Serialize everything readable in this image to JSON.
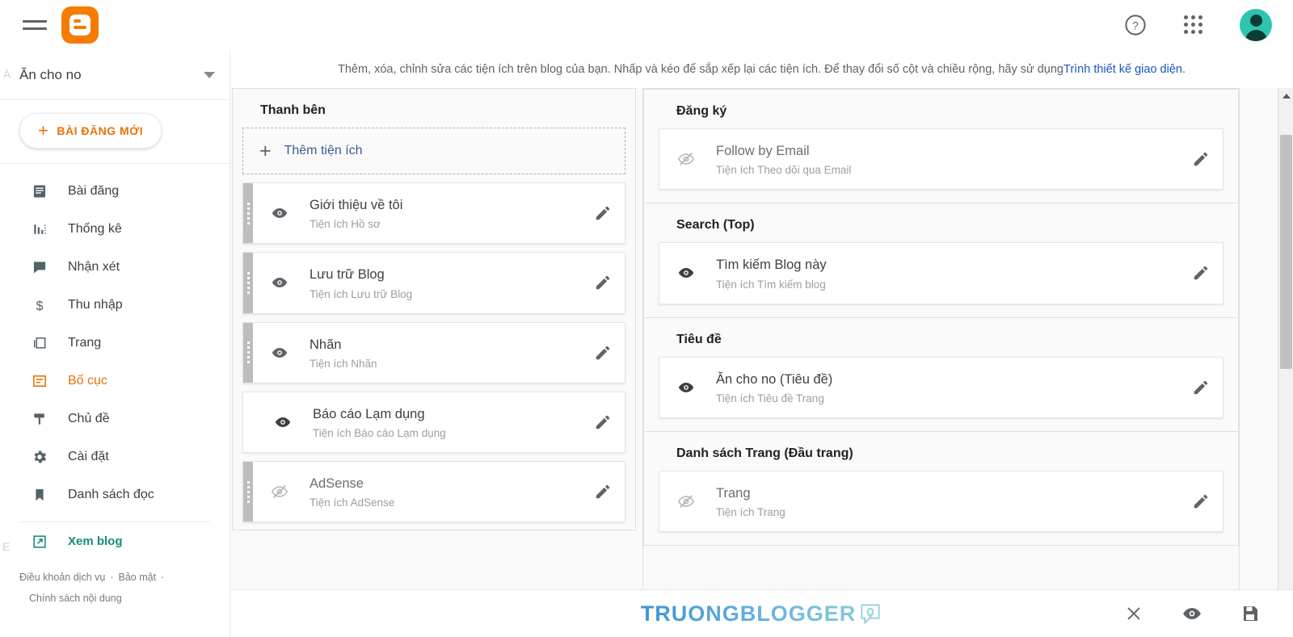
{
  "topbar": {
    "menu_icon": "hamburger-menu-icon",
    "logo_icon": "blogger-logo-icon",
    "help_icon": "help-circle-icon",
    "apps_icon": "google-apps-grid-icon",
    "avatar_icon": "user-avatar-icon",
    "avatar_color": "#2ec4b0"
  },
  "leftnav": {
    "blog_name": "Ăn cho no",
    "dropdown_icon": "chevron-down-icon",
    "new_post_label": "BÀI ĐĂNG MỚI",
    "new_post_plus": "+",
    "items": [
      {
        "label": "Bài đăng",
        "icon": "posts-icon",
        "active": false
      },
      {
        "label": "Thống kê",
        "icon": "stats-icon",
        "active": false
      },
      {
        "label": "Nhận xét",
        "icon": "comments-icon",
        "active": false
      },
      {
        "label": "Thu nhập",
        "icon": "earnings-icon",
        "active": false
      },
      {
        "label": "Trang",
        "icon": "pages-icon",
        "active": false
      },
      {
        "label": "Bố cục",
        "icon": "layout-icon",
        "active": true
      },
      {
        "label": "Chủ đề",
        "icon": "theme-icon",
        "active": false
      },
      {
        "label": "Cài đặt",
        "icon": "settings-gear-icon",
        "active": false
      },
      {
        "label": "Danh sách đọc",
        "icon": "reading-list-bookmark-icon",
        "active": false
      }
    ],
    "view_blog": {
      "label": "Xem blog",
      "icon": "external-link-icon"
    },
    "legal": {
      "terms": "Điều khoản dịch vụ",
      "privacy": "Bảo mật",
      "content_policy": "Chính sách nội dung",
      "separator": "·"
    },
    "active_color": "#e8710a"
  },
  "hint": {
    "text": "Thêm, xóa, chỉnh sửa các tiện ích trên blog của bạn. Nhấp và kéo để sắp xếp lại các tiện ích. Để thay đổi số cột và chiều rộng, hãy sử dụng ",
    "link": "Trình thiết kế giao diện",
    "period": ".",
    "link_color": "#1a56c4"
  },
  "left_column": {
    "title": "Thanh bên",
    "add_widget": {
      "label": "Thêm tiện ích",
      "plus": "+"
    },
    "widgets": [
      {
        "name": "Giới thiệu về tôi",
        "sub": "Tiện ích Hồ sơ",
        "visible": true,
        "handle": true,
        "eye_icon": "eye-visible-icon",
        "edit_icon": "pencil-edit-icon"
      },
      {
        "name": "Lưu trữ Blog",
        "sub": "Tiện ích Lưu trữ Blog",
        "visible": true,
        "handle": true,
        "eye_icon": "eye-visible-icon",
        "edit_icon": "pencil-edit-icon"
      },
      {
        "name": "Nhãn",
        "sub": "Tiện ích Nhãn",
        "visible": true,
        "handle": true,
        "eye_icon": "eye-visible-icon",
        "edit_icon": "pencil-edit-icon"
      },
      {
        "name": "Báo cáo Lạm dụng",
        "sub": "Tiện ích Báo cáo Lạm dụng",
        "visible": true,
        "handle": false,
        "eye_icon": "eye-visible-icon",
        "edit_icon": "pencil-edit-icon"
      },
      {
        "name": "AdSense",
        "sub": "Tiện ích AdSense",
        "visible": false,
        "handle": true,
        "eye_icon": "eye-hidden-icon",
        "edit_icon": "pencil-edit-icon"
      }
    ]
  },
  "right_column": {
    "sections": [
      {
        "title": "Đăng ký",
        "widgets": [
          {
            "name": "Follow by Email",
            "sub": "Tiện ích Theo dõi qua Email",
            "visible": false,
            "eye_icon": "eye-hidden-icon",
            "edit_icon": "pencil-edit-icon"
          }
        ]
      },
      {
        "title": "Search (Top)",
        "widgets": [
          {
            "name": "Tìm kiếm Blog này",
            "sub": "Tiện ích Tìm kiếm blog",
            "visible": true,
            "eye_icon": "eye-visible-icon",
            "edit_icon": "pencil-edit-icon"
          }
        ]
      },
      {
        "title": "Tiêu đề",
        "widgets": [
          {
            "name": "Ăn cho no (Tiêu đề)",
            "sub": "Tiện ích Tiêu đề Trang",
            "visible": true,
            "eye_icon": "eye-visible-icon",
            "edit_icon": "pencil-edit-icon"
          }
        ]
      },
      {
        "title": "Danh sách Trang (Đầu trang)",
        "widgets": [
          {
            "name": "Trang",
            "sub": "Tiện ích Trang",
            "visible": false,
            "eye_icon": "eye-hidden-icon",
            "edit_icon": "pencil-edit-icon"
          }
        ]
      }
    ]
  },
  "scrollbar": {
    "up_icon": "scroll-up-arrow-icon",
    "down_icon": "scroll-down-arrow-icon",
    "thumb": "scrollbar-thumb"
  },
  "bottombar": {
    "watermark": "TRUONGBLOGGER",
    "watermark_icon": "lightbulb-speech-bubble-icon",
    "close_icon": "close-x-icon",
    "preview_icon": "eye-preview-icon",
    "save_icon": "save-floppy-disk-icon"
  },
  "ghosts": {
    "g1": "À",
    "g2": "E"
  }
}
